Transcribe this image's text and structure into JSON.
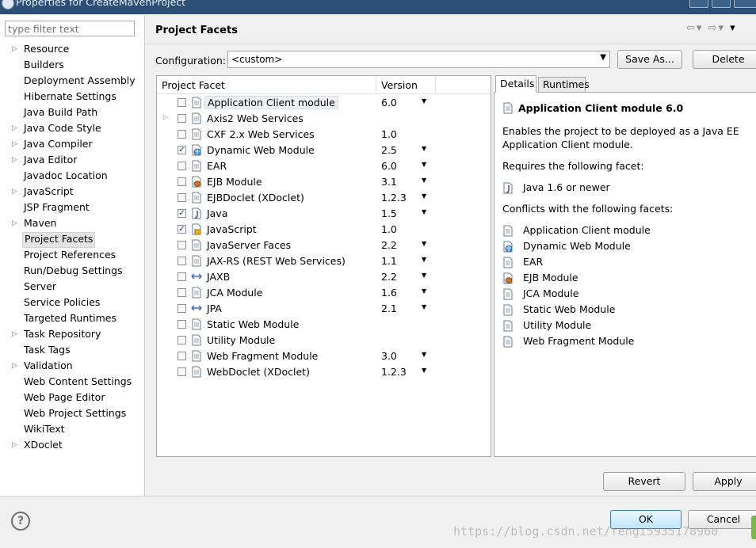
{
  "window": {
    "title": "Properties for CreateMavenProject"
  },
  "filter": {
    "placeholder": "type filter text"
  },
  "nav": {
    "items": [
      {
        "label": "Resource",
        "expandable": true
      },
      {
        "label": "Builders",
        "expandable": false
      },
      {
        "label": "Deployment Assembly",
        "expandable": false
      },
      {
        "label": "Hibernate Settings",
        "expandable": false
      },
      {
        "label": "Java Build Path",
        "expandable": false
      },
      {
        "label": "Java Code Style",
        "expandable": true
      },
      {
        "label": "Java Compiler",
        "expandable": true
      },
      {
        "label": "Java Editor",
        "expandable": true
      },
      {
        "label": "Javadoc Location",
        "expandable": false
      },
      {
        "label": "JavaScript",
        "expandable": true
      },
      {
        "label": "JSP Fragment",
        "expandable": false
      },
      {
        "label": "Maven",
        "expandable": true
      },
      {
        "label": "Project Facets",
        "expandable": false,
        "selected": true
      },
      {
        "label": "Project References",
        "expandable": false
      },
      {
        "label": "Run/Debug Settings",
        "expandable": false
      },
      {
        "label": "Server",
        "expandable": false
      },
      {
        "label": "Service Policies",
        "expandable": false
      },
      {
        "label": "Targeted Runtimes",
        "expandable": false
      },
      {
        "label": "Task Repository",
        "expandable": true
      },
      {
        "label": "Task Tags",
        "expandable": false
      },
      {
        "label": "Validation",
        "expandable": true
      },
      {
        "label": "Web Content Settings",
        "expandable": false
      },
      {
        "label": "Web Page Editor",
        "expandable": false
      },
      {
        "label": "Web Project Settings",
        "expandable": false
      },
      {
        "label": "WikiText",
        "expandable": false
      },
      {
        "label": "XDoclet",
        "expandable": true
      }
    ]
  },
  "page": {
    "title": "Project Facets",
    "configuration_label": "Configuration:",
    "configuration_value": "<custom>",
    "save_as": "Save As...",
    "delete": "Delete"
  },
  "facets": {
    "col_facet": "Project Facet",
    "col_version": "Version",
    "rows": [
      {
        "name": "Application Client module",
        "version": "6.0",
        "checked": false,
        "dropdown": true,
        "icon": "page-icon",
        "highlighted": true
      },
      {
        "name": "Axis2 Web Services",
        "version": "",
        "checked": false,
        "dropdown": false,
        "icon": "page-icon",
        "expandable": true
      },
      {
        "name": "CXF 2.x Web Services",
        "version": "1.0",
        "checked": false,
        "dropdown": false,
        "icon": "page-icon"
      },
      {
        "name": "Dynamic Web Module",
        "version": "2.5",
        "checked": true,
        "dropdown": true,
        "icon": "globe-page-icon"
      },
      {
        "name": "EAR",
        "version": "6.0",
        "checked": false,
        "dropdown": true,
        "icon": "page-icon"
      },
      {
        "name": "EJB Module",
        "version": "3.1",
        "checked": false,
        "dropdown": true,
        "icon": "bean-icon"
      },
      {
        "name": "EJBDoclet (XDoclet)",
        "version": "1.2.3",
        "checked": false,
        "dropdown": true,
        "icon": "page-icon"
      },
      {
        "name": "Java",
        "version": "1.5",
        "checked": true,
        "dropdown": true,
        "icon": "java-icon"
      },
      {
        "name": "JavaScript",
        "version": "1.0",
        "checked": true,
        "dropdown": false,
        "icon": "js-page-icon"
      },
      {
        "name": "JavaServer Faces",
        "version": "2.2",
        "checked": false,
        "dropdown": true,
        "icon": "page-icon"
      },
      {
        "name": "JAX-RS (REST Web Services)",
        "version": "1.1",
        "checked": false,
        "dropdown": true,
        "icon": "page-icon"
      },
      {
        "name": "JAXB",
        "version": "2.2",
        "checked": false,
        "dropdown": true,
        "icon": "arrows-icon"
      },
      {
        "name": "JCA Module",
        "version": "1.6",
        "checked": false,
        "dropdown": true,
        "icon": "page-icon"
      },
      {
        "name": "JPA",
        "version": "2.1",
        "checked": false,
        "dropdown": true,
        "icon": "arrows-icon"
      },
      {
        "name": "Static Web Module",
        "version": "",
        "checked": false,
        "dropdown": false,
        "icon": "page-icon"
      },
      {
        "name": "Utility Module",
        "version": "",
        "checked": false,
        "dropdown": false,
        "icon": "page-icon"
      },
      {
        "name": "Web Fragment Module",
        "version": "3.0",
        "checked": false,
        "dropdown": true,
        "icon": "page-icon"
      },
      {
        "name": "WebDoclet (XDoclet)",
        "version": "1.2.3",
        "checked": false,
        "dropdown": true,
        "icon": "page-icon"
      }
    ]
  },
  "details": {
    "tabs": [
      "Details",
      "Runtimes"
    ],
    "title": "Application Client module 6.0",
    "description_1": "Enables the project to be deployed as a Java EE",
    "description_2": "Application Client module.",
    "requires_label": "Requires the following facet:",
    "requires": [
      {
        "name": "Java 1.6 or newer",
        "icon": "java-icon"
      }
    ],
    "conflicts_label": "Conflicts with the following facets:",
    "conflicts": [
      {
        "name": "Application Client module",
        "icon": "page-icon"
      },
      {
        "name": "Dynamic Web Module",
        "icon": "globe-page-icon"
      },
      {
        "name": "EAR",
        "icon": "page-icon"
      },
      {
        "name": "EJB Module",
        "icon": "bean-icon"
      },
      {
        "name": "JCA Module",
        "icon": "page-icon"
      },
      {
        "name": "Static Web Module",
        "icon": "page-icon"
      },
      {
        "name": "Utility Module",
        "icon": "page-icon"
      },
      {
        "name": "Web Fragment Module",
        "icon": "page-icon"
      }
    ]
  },
  "buttons": {
    "revert": "Revert",
    "apply": "Apply",
    "ok": "OK",
    "cancel": "Cancel",
    "help": "?"
  },
  "watermark": "https://blog.csdn.net/fengi5935178960"
}
